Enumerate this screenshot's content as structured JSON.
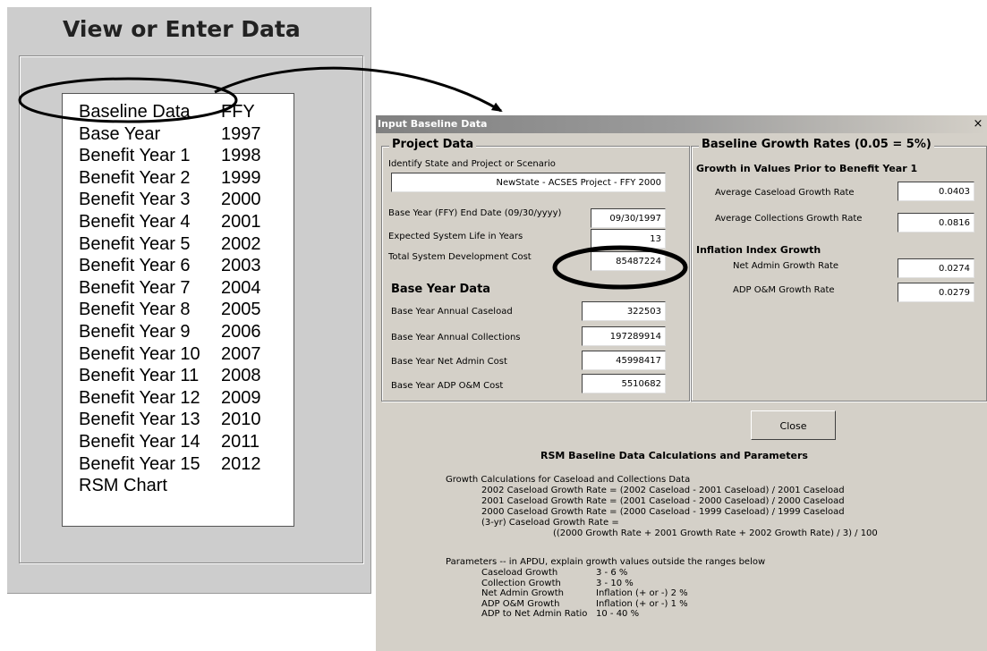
{
  "left_panel": {
    "title": "View or Enter Data",
    "items": [
      {
        "name": "Baseline Data",
        "year": "FFY"
      },
      {
        "name": "Base Year",
        "year": "1997"
      },
      {
        "name": "Benefit Year 1",
        "year": "1998"
      },
      {
        "name": "Benefit Year 2",
        "year": "1999"
      },
      {
        "name": "Benefit Year 3",
        "year": "2000"
      },
      {
        "name": "Benefit Year 4",
        "year": "2001"
      },
      {
        "name": "Benefit Year 5",
        "year": "2002"
      },
      {
        "name": "Benefit Year 6",
        "year": "2003"
      },
      {
        "name": "Benefit Year 7",
        "year": "2004"
      },
      {
        "name": "Benefit Year 8",
        "year": "2005"
      },
      {
        "name": "Benefit Year 9",
        "year": "2006"
      },
      {
        "name": "Benefit Year 10",
        "year": "2007"
      },
      {
        "name": "Benefit Year 11",
        "year": "2008"
      },
      {
        "name": "Benefit Year 12",
        "year": "2009"
      },
      {
        "name": "Benefit Year 13",
        "year": "2010"
      },
      {
        "name": "Benefit Year 14",
        "year": "2011"
      },
      {
        "name": "Benefit Year 15",
        "year": "2012"
      },
      {
        "name": "RSM Chart",
        "year": ""
      }
    ]
  },
  "dialog": {
    "title": "Input Baseline Data",
    "close_glyph": "×",
    "project_data": {
      "heading": "Project Data",
      "identify_label": "Identify State and Project or Scenario",
      "identify_value": "NewState - ACSES Project - FFY 2000",
      "base_year_end_label": "Base Year (FFY) End Date (09/30/yyyy)",
      "base_year_end_value": "09/30/1997",
      "life_label": "Expected System Life in Years",
      "life_value": "13",
      "dev_cost_label": "Total System Development Cost",
      "dev_cost_value": "85487224"
    },
    "base_year_data": {
      "heading": "Base Year Data",
      "caseload_label": "Base Year Annual Caseload",
      "caseload_value": "322503",
      "collections_label": "Base Year Annual Collections",
      "collections_value": "197289914",
      "net_admin_label": "Base Year Net Admin Cost",
      "net_admin_value": "45998417",
      "adp_label": "Base Year ADP O&M Cost",
      "adp_value": "5510682"
    },
    "growth_rates": {
      "heading": "Baseline Growth Rates (0.05 = 5%)",
      "prior_heading": "Growth in Values Prior to Benefit Year 1",
      "caseload_label": "Average Caseload Growth Rate",
      "caseload_value": "0.0403",
      "collections_label": "Average Collections Growth Rate",
      "collections_value": "0.0816",
      "inflation_heading": "Inflation Index Growth",
      "net_admin_label": "Net Admin Growth Rate",
      "net_admin_value": "0.0274",
      "adp_label": "ADP O&M Growth Rate",
      "adp_value": "0.0279"
    },
    "close_button": "Close",
    "calc_heading": "RSM Baseline Data Calculations and Parameters",
    "calc_lines": {
      "l0": "Growth Calculations for Caseload and Collections Data",
      "l1": "2002 Caseload Growth Rate = (2002 Caseload - 2001 Caseload) / 2001 Caseload",
      "l2": "2001 Caseload Growth Rate = (2001 Caseload - 2000 Caseload) / 2000 Caseload",
      "l3": "2000 Caseload Growth Rate = (2000 Caseload - 1999 Caseload) / 1999 Caseload",
      "l4": "(3-yr) Caseload Growth Rate =",
      "l5": "((2000 Growth Rate + 2001 Growth Rate + 2002 Growth Rate) / 3) / 100"
    },
    "params_heading": "Parameters -- in APDU, explain growth values outside the ranges below",
    "params": [
      {
        "name": "Caseload Growth",
        "range": "3 - 6 %"
      },
      {
        "name": "Collection Growth",
        "range": "3 - 10 %"
      },
      {
        "name": "Net Admin Growth",
        "range": "Inflation (+ or -) 2 %"
      },
      {
        "name": "ADP O&M Growth",
        "range": "Inflation (+ or -) 1 %"
      },
      {
        "name": "ADP to Net Admin Ratio",
        "range": "10 - 40 %"
      }
    ]
  }
}
